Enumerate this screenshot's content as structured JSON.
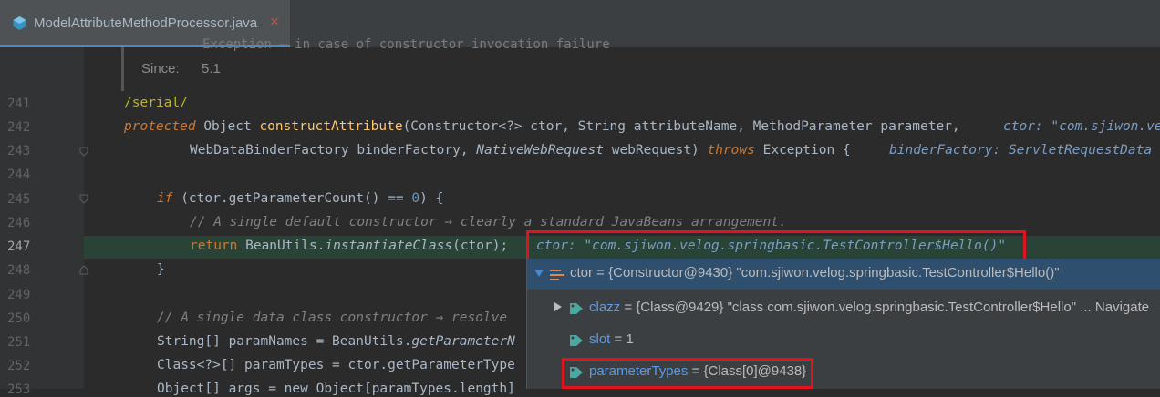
{
  "tab": {
    "title": "ModelAttributeMethodProcessor.java",
    "close": "×"
  },
  "doc": {
    "exception_line": "Exception – in case of constructor invocation failure",
    "since_label": "Since:",
    "since_value": "5.1"
  },
  "gutter": {
    "lines": [
      "241",
      "242",
      "243",
      "244",
      "245",
      "246",
      "247",
      "248",
      "249",
      "250",
      "251",
      "252",
      "253"
    ]
  },
  "code": {
    "l241": "/serial/",
    "l242": {
      "kw": "protected",
      "ret": "Object",
      "name": "constructAttribute",
      "rest": "(Constructor<?> ctor, String attributeName, MethodParameter parameter,",
      "hint": "ctor: \"com.sjiwon.ve"
    },
    "l243": {
      "t1": "WebDataBinderFactory",
      "p1": " binderFactory, ",
      "t2": "NativeWebRequest",
      "p2": " webRequest) ",
      "kw": "throws",
      "ex": " Exception {",
      "hint": "binderFactory: ServletRequestData"
    },
    "l245": {
      "kw": "if",
      "a": " (ctor.",
      "call": "getParameterCount",
      "b": "() == ",
      "num": "0",
      "c": ") {"
    },
    "l246": "// A single default constructor → clearly a standard JavaBeans arrangement.",
    "l247": {
      "kw": "return",
      "cls": " BeanUtils.",
      "call": "instantiateClass",
      "rest": "(ctor);",
      "hint": "ctor: \"com.sjiwon.velog.springbasic.TestController$Hello()\""
    },
    "l248": "}",
    "l250": "// A single data class constructor → resolve",
    "l251": {
      "a": "String[] paramNames = BeanUtils.",
      "call": "getParameterN"
    },
    "l252": "Class<?>[] paramTypes = ctor.getParameterType",
    "l253": "Object[] args = new Object[paramTypes.length]"
  },
  "debug": {
    "root": {
      "name": "ctor",
      "value": " = {Constructor@9430} \"com.sjiwon.velog.springbasic.TestController$Hello()\""
    },
    "fields": [
      {
        "name": "clazz",
        "value": " = {Class@9429} \"class com.sjiwon.velog.springbasic.TestController$Hello\" ... ",
        "link": "Navigate"
      },
      {
        "name": "slot",
        "value": " = 1"
      },
      {
        "name": "parameterTypes",
        "value": " = {Class[0]@9438}"
      }
    ]
  },
  "colors": {
    "accent": "#4a88c7",
    "highlight_box": "#e0141e",
    "current_line": "#294436"
  }
}
